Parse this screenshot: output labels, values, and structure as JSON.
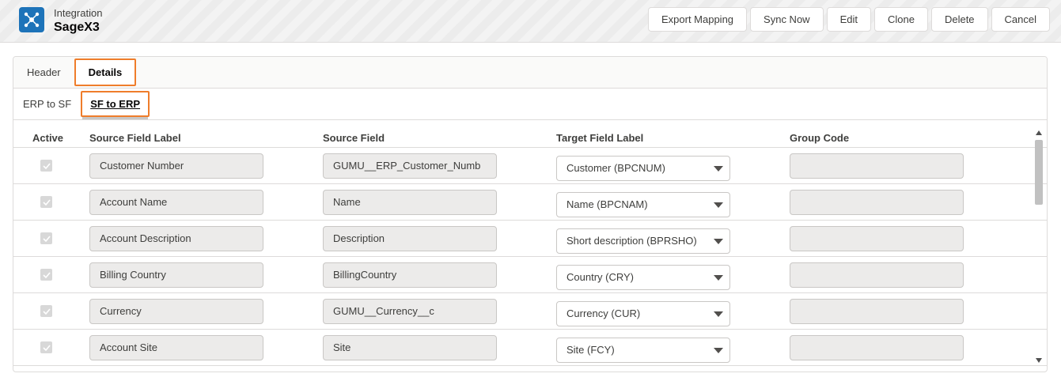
{
  "header": {
    "subtitle": "Integration",
    "title": "SageX3",
    "icon": "integration-icon",
    "buttons": [
      {
        "label": "Export Mapping"
      },
      {
        "label": "Sync Now"
      },
      {
        "label": "Edit"
      },
      {
        "label": "Clone"
      },
      {
        "label": "Delete"
      },
      {
        "label": "Cancel"
      }
    ]
  },
  "tabs": {
    "top": [
      "Header",
      "Details"
    ],
    "top_active": "Details",
    "sub": [
      "ERP to SF",
      "SF to ERP"
    ],
    "sub_active": "SF to ERP"
  },
  "table": {
    "columns": [
      "Active",
      "Source Field Label",
      "Source Field",
      "Target Field Label",
      "Group Code"
    ],
    "rows": [
      {
        "active": true,
        "source_label": "Customer Number",
        "source_field": "GUMU__ERP_Customer_Numb",
        "target_label": "Customer (BPCNUM)",
        "group_code": ""
      },
      {
        "active": true,
        "source_label": "Account Name",
        "source_field": "Name",
        "target_label": "Name (BPCNAM)",
        "group_code": ""
      },
      {
        "active": true,
        "source_label": "Account Description",
        "source_field": "Description",
        "target_label": "Short description (BPRSHO)",
        "group_code": ""
      },
      {
        "active": true,
        "source_label": "Billing Country",
        "source_field": "BillingCountry",
        "target_label": "Country (CRY)",
        "group_code": ""
      },
      {
        "active": true,
        "source_label": "Currency",
        "source_field": "GUMU__Currency__c",
        "target_label": "Currency (CUR)",
        "group_code": ""
      },
      {
        "active": true,
        "source_label": "Account Site",
        "source_field": "Site",
        "target_label": "Site (FCY)",
        "group_code": ""
      }
    ]
  },
  "colors": {
    "highlight": "#ef7d2b",
    "app_icon_bg": "#1d73b9"
  }
}
